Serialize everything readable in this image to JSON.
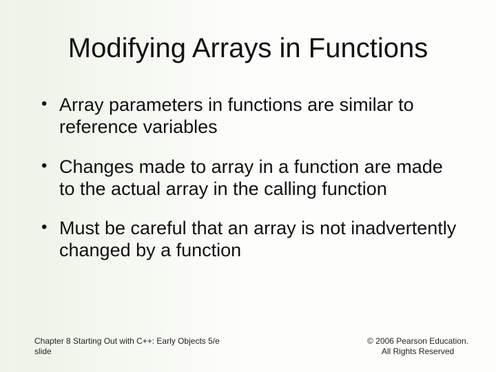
{
  "title": "Modifying Arrays in Functions",
  "bullets": [
    "Array parameters in functions are similar to reference variables",
    "Changes made to array in a function are made to the actual array in the calling function",
    "Must be careful that an array is not inadvertently changed by a function"
  ],
  "footer": {
    "left_line1": "Chapter 8 Starting Out with C++: Early Objects 5/e",
    "left_line2": "slide",
    "right_line1": "© 2006 Pearson Education.",
    "right_line2": "All Rights Reserved"
  }
}
